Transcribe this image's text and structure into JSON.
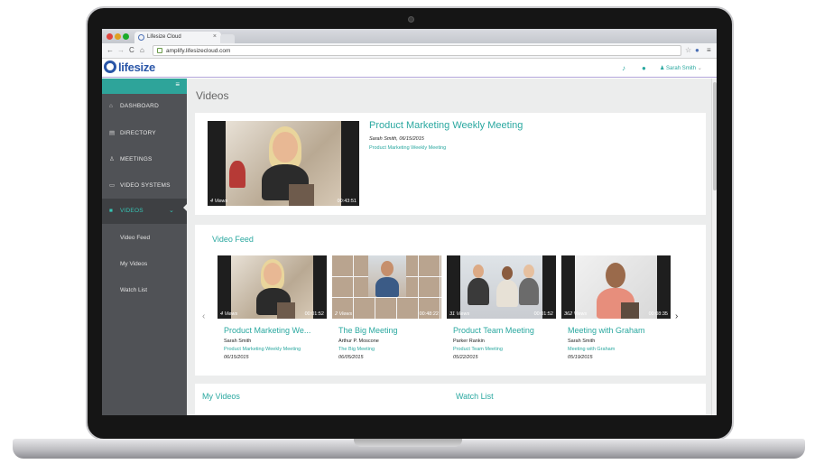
{
  "browser": {
    "tab_title": "Lifesize Cloud",
    "url": "amplify.lifesizecloud.com"
  },
  "header": {
    "logo_text": "lifesize",
    "user_name": "Sarah Smith"
  },
  "sidebar": {
    "items": [
      {
        "label": "DASHBOARD",
        "icon": "home-icon"
      },
      {
        "label": "DIRECTORY",
        "icon": "contacts-icon"
      },
      {
        "label": "MEETINGS",
        "icon": "meetings-icon"
      },
      {
        "label": "VIDEO SYSTEMS",
        "icon": "monitor-icon"
      },
      {
        "label": "VIDEOS",
        "icon": "video-camera-icon",
        "active": true
      }
    ],
    "subitems": [
      "Video Feed",
      "My Videos",
      "Watch List"
    ]
  },
  "page": {
    "title": "Videos"
  },
  "featured": {
    "title": "Product Marketing Weekly Meeting",
    "author_date": "Sarah Smith, 06/15/2015",
    "meeting": "Product Marketing Weekly Meeting",
    "views": "4 Views",
    "duration": "00:43:51"
  },
  "feed": {
    "title": "Video Feed",
    "videos": [
      {
        "views": "4 Views",
        "duration": "00:01:52",
        "title": "Product Marketing We...",
        "author": "Sarah Smith",
        "meeting": "Product Marketing Weekly Meeting",
        "date": "06/15/2015"
      },
      {
        "views": "2 Views",
        "duration": "00:48:22",
        "title": "The Big Meeting",
        "author": "Arthur P. Moscone",
        "meeting": "The Big Meeting",
        "date": "06/05/2015"
      },
      {
        "views": "31 Views",
        "duration": "00:01:52",
        "title": "Product Team Meeting",
        "author": "Parker Rankin",
        "meeting": "Product Team Meeting",
        "date": "05/22/2015"
      },
      {
        "views": "362 Views",
        "duration": "00:08:35",
        "title": "Meeting with Graham",
        "author": "Sarah Smith",
        "meeting": "Meeting with Graham",
        "date": "05/19/2015"
      }
    ]
  },
  "sections": {
    "my_videos": "My Videos",
    "watch_list": "Watch List"
  },
  "colors": {
    "accent": "#2aa8a0",
    "sidebar": "#505256",
    "brand": "#2a56a8"
  }
}
